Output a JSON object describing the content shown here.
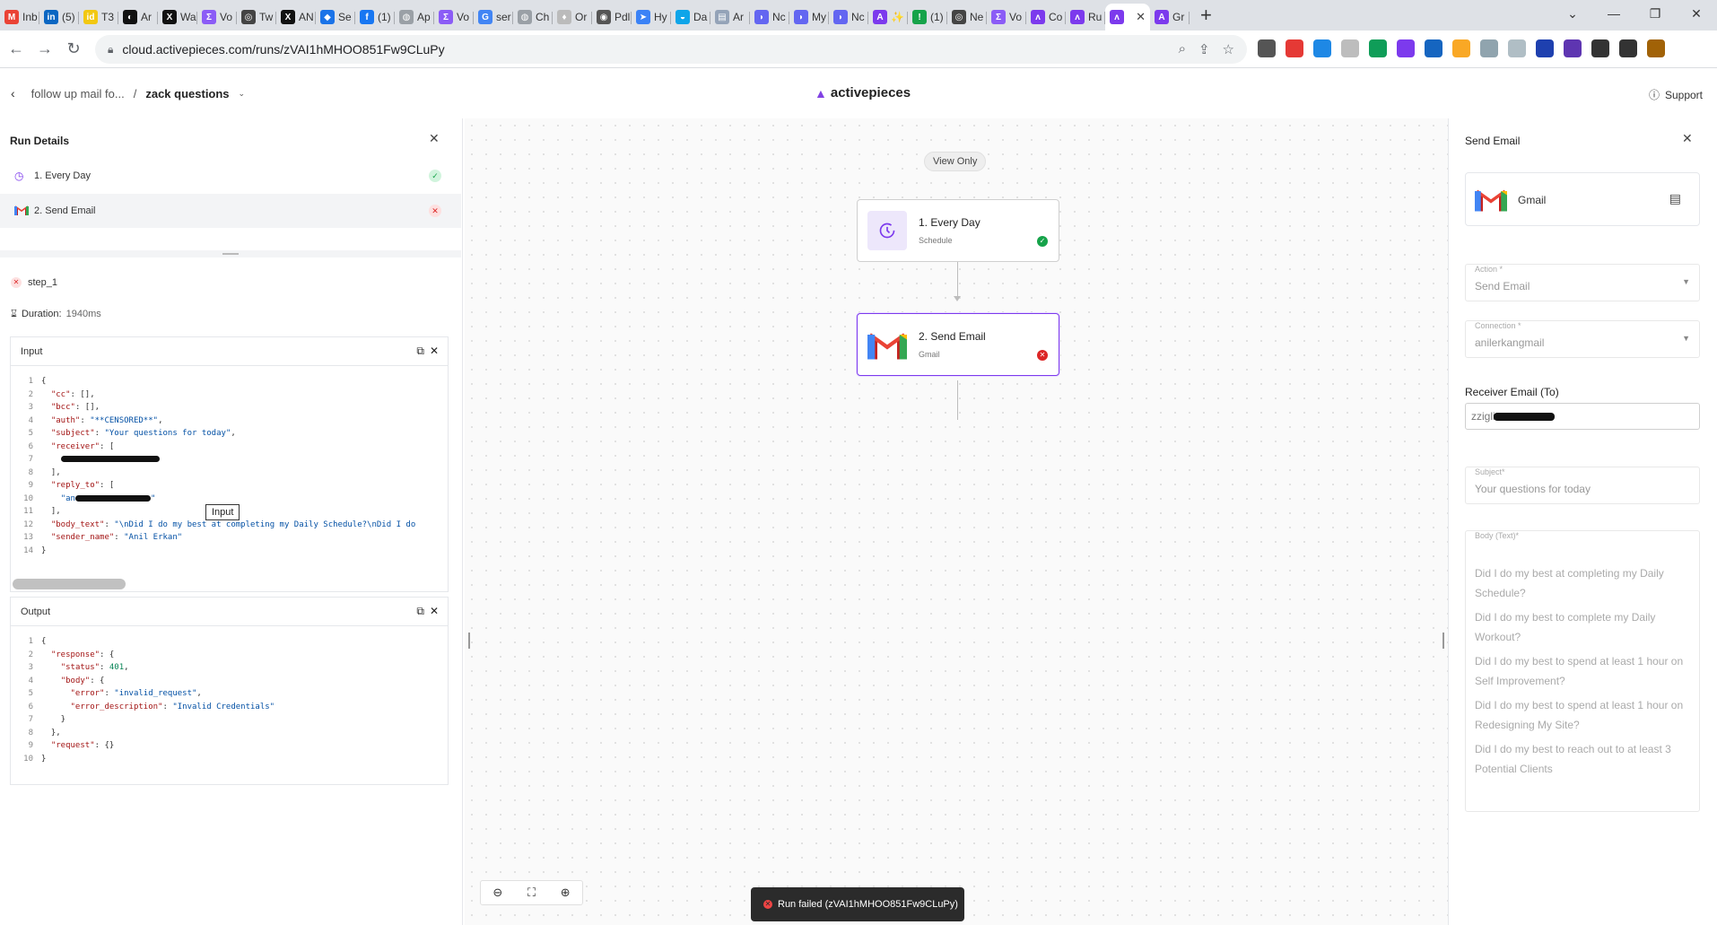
{
  "browser": {
    "tabs": [
      {
        "label": "Inb",
        "color": "#ea4335",
        "glyph": "M"
      },
      {
        "label": "(5)",
        "color": "#0a66c2",
        "glyph": "in"
      },
      {
        "label": "T3",
        "color": "#f2c811",
        "glyph": "id"
      },
      {
        "label": "Ar",
        "color": "#111111",
        "glyph": "◐"
      },
      {
        "label": "Wa",
        "color": "#111111",
        "glyph": "X"
      },
      {
        "label": "Vo",
        "color": "#8b5cf6",
        "glyph": "Σ"
      },
      {
        "label": "Tw",
        "color": "#444444",
        "glyph": "◎"
      },
      {
        "label": "AN",
        "color": "#111111",
        "glyph": "X"
      },
      {
        "label": "Se",
        "color": "#1a73e8",
        "glyph": "◆"
      },
      {
        "label": "(1)",
        "color": "#1877f2",
        "glyph": "f"
      },
      {
        "label": "Ap",
        "color": "#9aa0a6",
        "glyph": "◍"
      },
      {
        "label": "Vo",
        "color": "#8b5cf6",
        "glyph": "Σ"
      },
      {
        "label": "ser",
        "color": "#4285f4",
        "glyph": "G"
      },
      {
        "label": "Ch",
        "color": "#9aa0a6",
        "glyph": "◍"
      },
      {
        "label": "Or",
        "color": "#bbbbbb",
        "glyph": "♦"
      },
      {
        "label": "Pdl",
        "color": "#555555",
        "glyph": "◉"
      },
      {
        "label": "Hy",
        "color": "#3b82f6",
        "glyph": "➤"
      },
      {
        "label": "Da",
        "color": "#0ea5e9",
        "glyph": "◒"
      },
      {
        "label": "Ar",
        "color": "#94a3b8",
        "glyph": "▤"
      },
      {
        "label": "Nc",
        "color": "#6366f1",
        "glyph": "◗"
      },
      {
        "label": "My",
        "color": "#6366f1",
        "glyph": "◗"
      },
      {
        "label": "Nc",
        "color": "#6366f1",
        "glyph": "◗"
      },
      {
        "label": "✨",
        "color": "#7c3aed",
        "glyph": "A"
      },
      {
        "label": "(1)",
        "color": "#16a34a",
        "glyph": "!"
      },
      {
        "label": "Ne",
        "color": "#444444",
        "glyph": "◎"
      },
      {
        "label": "Vo",
        "color": "#8b5cf6",
        "glyph": "Σ"
      },
      {
        "label": "Co",
        "color": "#7c3aed",
        "glyph": "ᴧ"
      },
      {
        "label": "Ru",
        "color": "#7c3aed",
        "glyph": "ᴧ"
      },
      {
        "label": "",
        "color": "#7c3aed",
        "glyph": "ᴧ",
        "active": true
      },
      {
        "label": "Gr",
        "color": "#7c3aed",
        "glyph": "A"
      }
    ],
    "url": "cloud.activepieces.com/runs/zVAI1hMHOO851Fw9CLuPy",
    "extension_colors": [
      "#555555",
      "#e53935",
      "#1e88e5",
      "#bdbdbd",
      "#0f9d58",
      "#7c3aed",
      "#1565c0",
      "#f9a825",
      "#90a4ae",
      "#b0bec5",
      "#1e40af",
      "#5e35b1",
      "#333333",
      "#333333",
      "#a16207"
    ]
  },
  "header": {
    "parent_crumb": "follow up mail fo...",
    "flow_name": "zack questions",
    "logo_text": "activepieces",
    "support_label": "Support"
  },
  "run_details": {
    "title": "Run Details",
    "steps": [
      {
        "label": "1. Every Day",
        "status": "success"
      },
      {
        "label": "2. Send Email",
        "status": "failed"
      }
    ],
    "current_step": "step_1",
    "duration_label": "Duration:",
    "duration_value": "1940ms",
    "input_title": "Input",
    "output_title": "Output",
    "tooltip": "Input"
  },
  "input_json": [
    "{",
    "  \"cc\": [],",
    "  \"bcc\": [],",
    "  \"auth\": \"**CENSORED**\",",
    "  \"subject\": \"Your questions for today\",",
    "  \"receiver\": [",
    "    \"REDACTED\"",
    "  ],",
    "  \"reply_to\": [",
    "    \"an REDACTED \"",
    "  ],",
    "  \"body_text\": \"\\nDid I do my best at completing my Daily Schedule?\\nDid I do",
    "  \"sender_name\": \"Anil Erkan\"",
    "}"
  ],
  "output_json": [
    "{",
    "  \"response\": {",
    "    \"status\": 401,",
    "    \"body\": {",
    "      \"error\": \"invalid_request\",",
    "      \"error_description\": \"Invalid Credentials\"",
    "    }",
    "  },",
    "  \"request\": {}",
    "}"
  ],
  "canvas": {
    "view_only": "View Only",
    "nodes": [
      {
        "title": "1. Every Day",
        "subtitle": "Schedule",
        "status": "success"
      },
      {
        "title": "2. Send Email",
        "subtitle": "Gmail",
        "status": "failed"
      }
    ],
    "toast": "Run failed (zVAI1hMHOO851Fw9CLuPy)"
  },
  "step_settings": {
    "title": "Send Email",
    "piece_name": "Gmail",
    "action_label": "Action *",
    "action_value": "Send Email",
    "connection_label": "Connection *",
    "connection_value": "anilerkangmail",
    "receiver_label": "Receiver Email (To)",
    "receiver_value": "zziglio",
    "subject_label": "Subject*",
    "subject_value": "Your questions for today",
    "body_label": "Body (Text)*",
    "body_paragraphs": [
      "Did I do my best at completing my Daily Schedule?",
      "Did I do my best to complete my Daily Workout?",
      "Did I do my best to spend at least 1 hour on Self Improvement?",
      "Did I do my best to spend at least 1 hour on Redesigning My Site?",
      "Did I do my best to reach out to at least 3 Potential Clients"
    ]
  }
}
